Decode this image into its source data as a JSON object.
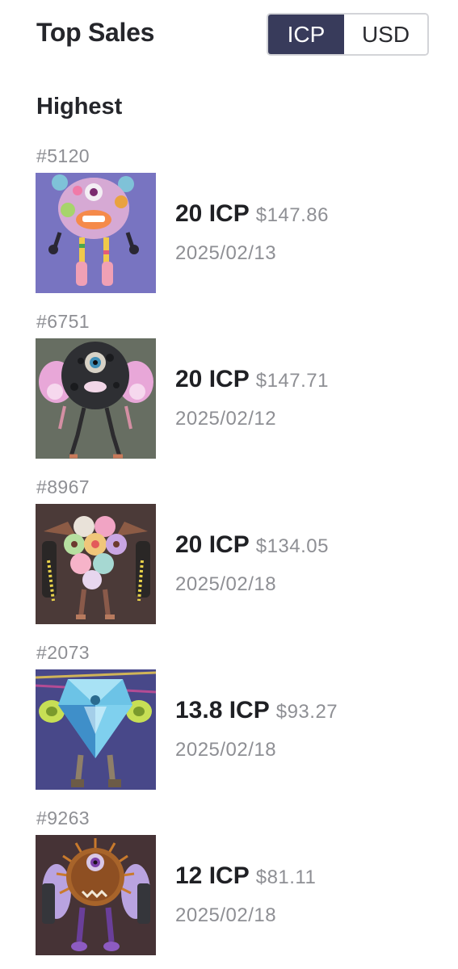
{
  "header": {
    "title": "Top Sales",
    "currency_toggle": {
      "options": [
        "ICP",
        "USD"
      ],
      "selected": "ICP"
    }
  },
  "section": {
    "title": "Highest"
  },
  "sales": [
    {
      "id": "#5120",
      "price_icp": "20 ICP",
      "price_usd": "$147.86",
      "date": "2025/02/13",
      "art": "fuzzy-cyclops-monster"
    },
    {
      "id": "#6751",
      "price_icp": "20 ICP",
      "price_usd": "$147.71",
      "date": "2025/02/12",
      "art": "cratered-orb-monster"
    },
    {
      "id": "#8967",
      "price_icp": "20 ICP",
      "price_usd": "$134.05",
      "date": "2025/02/18",
      "art": "bubble-cluster-monster"
    },
    {
      "id": "#2073",
      "price_icp": "13.8 ICP",
      "price_usd": "$93.27",
      "date": "2025/02/18",
      "art": "crystal-gem-monster"
    },
    {
      "id": "#9263",
      "price_icp": "12 ICP",
      "price_usd": "$81.11",
      "date": "2025/02/18",
      "art": "spiky-urchin-monster"
    }
  ]
}
